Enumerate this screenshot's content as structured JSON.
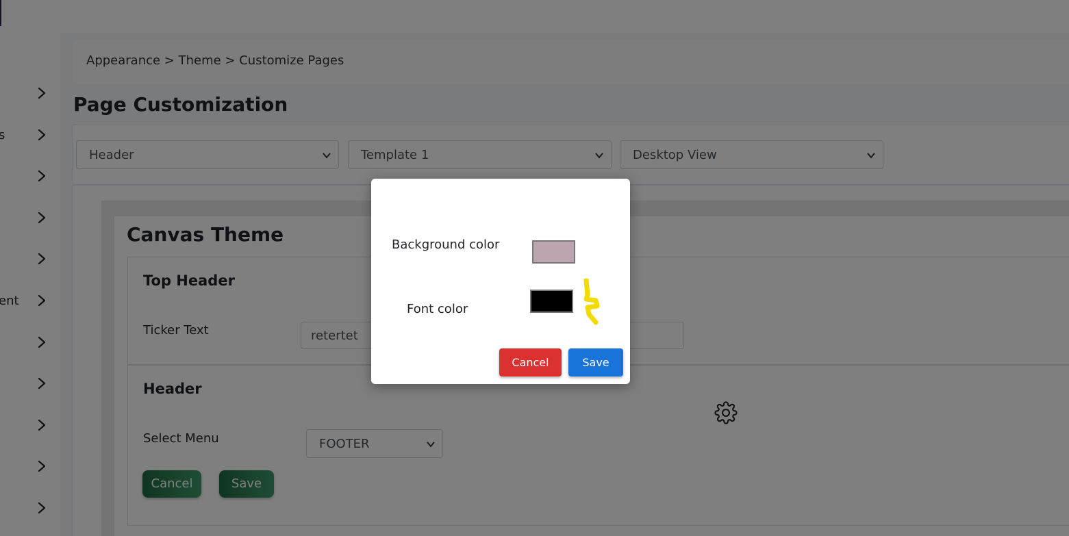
{
  "sidebar": {
    "items": [
      {
        "label": "",
        "icon": "chevron-right-icon"
      },
      {
        "label": "s",
        "icon": "chevron-right-icon"
      },
      {
        "label": "",
        "icon": "chevron-right-icon"
      },
      {
        "label": "",
        "icon": "chevron-right-icon"
      },
      {
        "label": "",
        "icon": "chevron-right-icon"
      },
      {
        "label": "ent",
        "icon": "chevron-right-icon"
      },
      {
        "label": "",
        "icon": "chevron-right-icon"
      },
      {
        "label": "",
        "icon": "chevron-right-icon"
      },
      {
        "label": "",
        "icon": "chevron-right-icon"
      },
      {
        "label": "",
        "icon": "chevron-right-icon"
      },
      {
        "label": "",
        "icon": "chevron-right-icon"
      }
    ]
  },
  "breadcrumb": "Appearance > Theme > Customize Pages",
  "page_title": "Page Customization",
  "filters": {
    "section": "Header",
    "template": "Template 1",
    "view": "Desktop View"
  },
  "canvas": {
    "title": "Canvas Theme",
    "top_header": {
      "title": "Top Header",
      "ticker_label": "Ticker Text",
      "ticker_value": "retertet"
    },
    "header": {
      "title": "Header",
      "menu_label": "Select Menu",
      "menu_value": "FOOTER",
      "cancel_label": "Cancel",
      "save_label": "Save"
    },
    "settings_icon": "gear-icon"
  },
  "modal": {
    "background_label": "Background color",
    "background_color": "#bca5b0",
    "font_label": "Font color",
    "font_color": "#000000",
    "cancel_label": "Cancel",
    "save_label": "Save",
    "cancel_color": "#dc3131",
    "save_color": "#1a73d8"
  }
}
